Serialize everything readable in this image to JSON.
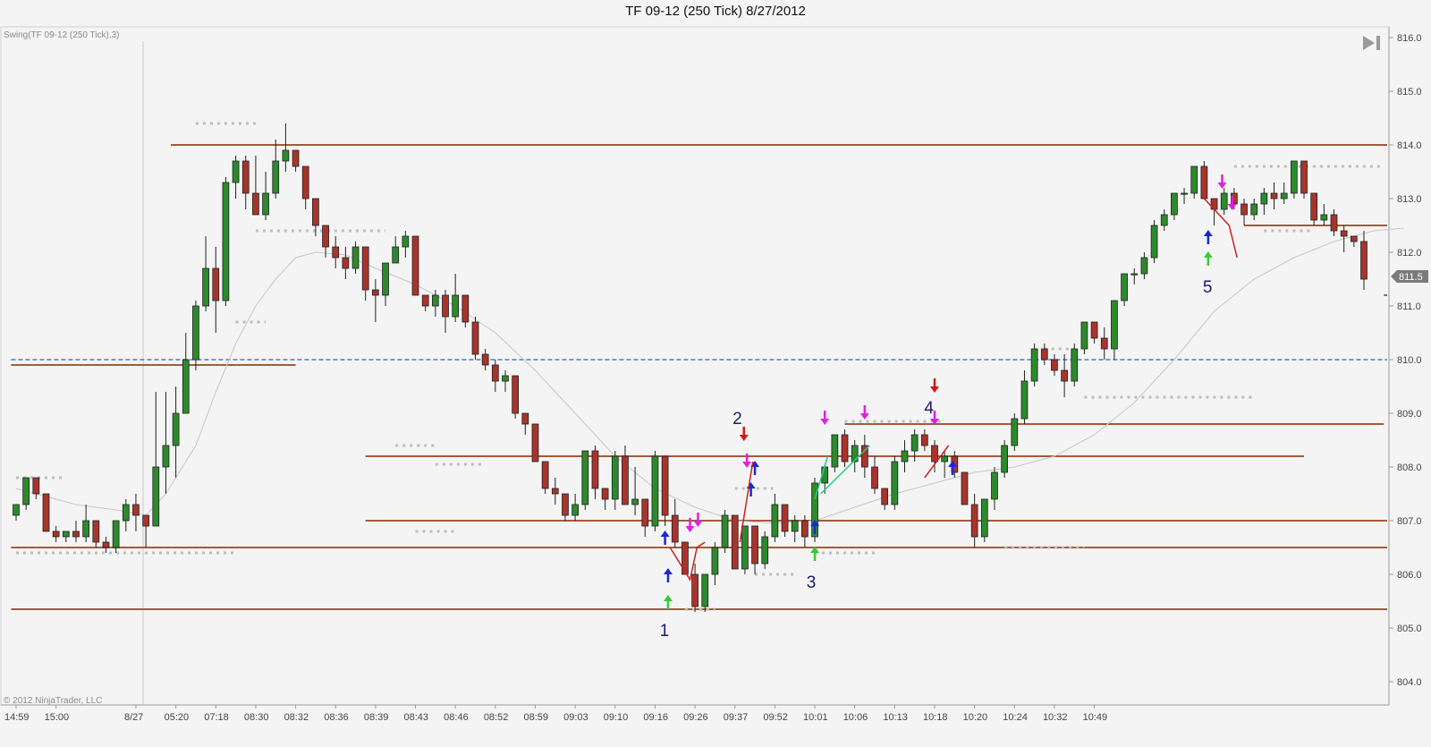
{
  "window": {
    "title": "TF 09-12 (250 Tick)  8/27/2012",
    "indicator_label": "Swing(TF 09-12 (250 Tick),3)",
    "copyright": "© 2012 NinjaTrader, LLC",
    "current_price_label": "811.5"
  },
  "colors": {
    "up_candle": "#2c8a2c",
    "down_candle": "#a8342c",
    "swing_line": "#a45a3a",
    "dotted_level": "#bdbdbd",
    "dashed_level": "#4a7fb5",
    "sma": "#c6c6c6",
    "magenta_arrow": "#e020e0",
    "blue_arrow": "#1a2ad0",
    "green_arrow": "#33cc33",
    "red_arrow": "#d01818",
    "swing_number": "#1a1a70",
    "axis_text": "#444444"
  },
  "icons": {
    "scroll_end": "scroll-to-end-icon"
  },
  "chart_data": {
    "type": "candlestick",
    "title": "TF 09-12 (250 Tick)  8/27/2012",
    "ylim": [
      803.7,
      816.1
    ],
    "y_ticks": [
      "816.0",
      "815.0",
      "814.0",
      "813.0",
      "812.0",
      "811.0",
      "810.0",
      "809.0",
      "808.0",
      "807.0",
      "806.0",
      "805.0",
      "804.0"
    ],
    "x_ticks": [
      {
        "i": 0,
        "label": "14:59"
      },
      {
        "i": 4,
        "label": "15:00"
      },
      {
        "i": 12,
        "label": "8/27"
      },
      {
        "i": 16,
        "label": "05:20"
      },
      {
        "i": 20,
        "label": "07:18"
      },
      {
        "i": 24,
        "label": "08:30"
      },
      {
        "i": 28,
        "label": "08:32"
      },
      {
        "i": 32,
        "label": "08:36"
      },
      {
        "i": 36,
        "label": "08:39"
      },
      {
        "i": 40,
        "label": "08:43"
      },
      {
        "i": 44,
        "label": "08:46"
      },
      {
        "i": 48,
        "label": "08:52"
      },
      {
        "i": 52,
        "label": "08:59"
      },
      {
        "i": 56,
        "label": "09:03"
      },
      {
        "i": 60,
        "label": "09:10"
      },
      {
        "i": 64,
        "label": "09:16"
      },
      {
        "i": 68,
        "label": "09:26"
      },
      {
        "i": 72,
        "label": "09:37"
      },
      {
        "i": 76,
        "label": "09:52"
      },
      {
        "i": 80,
        "label": "10:01"
      },
      {
        "i": 84,
        "label": "10:06"
      },
      {
        "i": 88,
        "label": "10:13"
      },
      {
        "i": 92,
        "label": "10:18"
      },
      {
        "i": 96,
        "label": "10:20"
      },
      {
        "i": 100,
        "label": "10:24"
      },
      {
        "i": 104,
        "label": "10:32"
      },
      {
        "i": 108,
        "label": "10:49"
      }
    ],
    "candles": [
      [
        807.1,
        807.3,
        807.0,
        807.3
      ],
      [
        807.3,
        807.8,
        807.2,
        807.8
      ],
      [
        807.8,
        807.8,
        807.4,
        807.5
      ],
      [
        807.5,
        807.5,
        806.8,
        806.8
      ],
      [
        806.8,
        806.9,
        806.6,
        806.7
      ],
      [
        806.7,
        806.8,
        806.6,
        806.8
      ],
      [
        806.8,
        807.0,
        806.6,
        806.7
      ],
      [
        806.7,
        807.3,
        806.6,
        807.0
      ],
      [
        807.0,
        807.0,
        806.5,
        806.6
      ],
      [
        806.6,
        806.7,
        806.4,
        806.5
      ],
      [
        806.5,
        807.0,
        806.4,
        807.0
      ],
      [
        807.0,
        807.4,
        806.8,
        807.3
      ],
      [
        807.3,
        807.5,
        806.8,
        807.1
      ],
      [
        807.1,
        807.1,
        806.5,
        806.9
      ],
      [
        806.9,
        809.4,
        806.9,
        808.0
      ],
      [
        808.0,
        809.4,
        807.5,
        808.4
      ],
      [
        808.4,
        809.5,
        807.8,
        809.0
      ],
      [
        809.0,
        810.5,
        809.0,
        810.0
      ],
      [
        810.0,
        811.1,
        809.8,
        811.0
      ],
      [
        811.0,
        812.3,
        810.9,
        811.7
      ],
      [
        811.7,
        812.1,
        810.5,
        811.1
      ],
      [
        811.1,
        813.4,
        811.0,
        813.3
      ],
      [
        813.3,
        813.8,
        813.0,
        813.7
      ],
      [
        813.7,
        813.8,
        812.8,
        813.1
      ],
      [
        813.1,
        813.8,
        812.7,
        812.7
      ],
      [
        812.7,
        813.5,
        812.6,
        813.1
      ],
      [
        813.1,
        814.1,
        813.0,
        813.7
      ],
      [
        813.7,
        814.4,
        813.5,
        813.9
      ],
      [
        813.9,
        813.9,
        813.5,
        813.6
      ],
      [
        813.6,
        813.6,
        812.8,
        813.0
      ],
      [
        813.0,
        813.0,
        812.3,
        812.5
      ],
      [
        812.5,
        812.5,
        811.9,
        812.1
      ],
      [
        812.1,
        812.3,
        811.7,
        811.9
      ],
      [
        811.9,
        812.1,
        811.5,
        811.7
      ],
      [
        811.7,
        812.2,
        811.6,
        812.1
      ],
      [
        812.1,
        812.1,
        811.1,
        811.3
      ],
      [
        811.3,
        811.5,
        810.7,
        811.2
      ],
      [
        811.2,
        811.6,
        811.0,
        811.8
      ],
      [
        811.8,
        812.3,
        811.8,
        812.1
      ],
      [
        812.1,
        812.4,
        811.9,
        812.3
      ],
      [
        812.3,
        812.3,
        811.2,
        811.2
      ],
      [
        811.2,
        811.2,
        810.9,
        811.0
      ],
      [
        811.0,
        811.3,
        810.8,
        811.2
      ],
      [
        811.2,
        811.3,
        810.5,
        810.8
      ],
      [
        810.8,
        811.6,
        810.7,
        811.2
      ],
      [
        811.2,
        811.2,
        810.6,
        810.7
      ],
      [
        810.7,
        810.8,
        810.0,
        810.1
      ],
      [
        810.1,
        810.2,
        809.8,
        809.9
      ],
      [
        809.9,
        810.0,
        809.4,
        809.6
      ],
      [
        809.6,
        809.8,
        809.4,
        809.7
      ],
      [
        809.7,
        809.7,
        808.9,
        809.0
      ],
      [
        809.0,
        809.0,
        808.6,
        808.8
      ],
      [
        808.8,
        808.8,
        808.1,
        808.1
      ],
      [
        808.1,
        808.1,
        807.5,
        807.6
      ],
      [
        807.6,
        807.8,
        807.3,
        807.5
      ],
      [
        807.5,
        807.5,
        807.0,
        807.1
      ],
      [
        807.1,
        807.5,
        807.0,
        807.3
      ],
      [
        807.3,
        808.3,
        807.2,
        808.3
      ],
      [
        808.3,
        808.4,
        807.4,
        807.6
      ],
      [
        807.6,
        807.6,
        807.2,
        807.4
      ],
      [
        807.4,
        808.3,
        807.2,
        808.2
      ],
      [
        808.2,
        808.4,
        807.3,
        807.3
      ],
      [
        807.3,
        808.0,
        807.1,
        807.4
      ],
      [
        807.4,
        807.4,
        806.7,
        806.9
      ],
      [
        806.9,
        808.3,
        806.8,
        808.2
      ],
      [
        808.2,
        808.2,
        806.9,
        807.1
      ],
      [
        807.1,
        807.4,
        806.5,
        806.6
      ],
      [
        806.6,
        806.6,
        806.0,
        806.0
      ],
      [
        806.0,
        806.2,
        805.3,
        805.4
      ],
      [
        805.4,
        806.0,
        805.3,
        806.0
      ],
      [
        806.0,
        806.6,
        805.8,
        806.5
      ],
      [
        806.5,
        807.2,
        806.4,
        807.1
      ],
      [
        807.1,
        807.1,
        806.1,
        806.1
      ],
      [
        806.1,
        806.9,
        806.0,
        806.9
      ],
      [
        806.9,
        806.9,
        806.0,
        806.2
      ],
      [
        806.2,
        806.8,
        806.1,
        806.7
      ],
      [
        806.7,
        807.5,
        806.6,
        807.3
      ],
      [
        807.3,
        807.3,
        806.7,
        806.8
      ],
      [
        806.8,
        807.1,
        806.6,
        807.0
      ],
      [
        807.0,
        807.1,
        806.5,
        806.7
      ],
      [
        806.7,
        807.8,
        806.6,
        807.7
      ],
      [
        807.7,
        808.0,
        807.5,
        808.0
      ],
      [
        808.0,
        808.6,
        807.9,
        808.6
      ],
      [
        808.6,
        808.7,
        808.0,
        808.1
      ],
      [
        808.1,
        808.5,
        807.9,
        808.4
      ],
      [
        808.4,
        808.6,
        807.8,
        808.0
      ],
      [
        808.0,
        808.2,
        807.5,
        807.6
      ],
      [
        807.6,
        807.6,
        807.2,
        807.3
      ],
      [
        807.3,
        808.2,
        807.2,
        808.1
      ],
      [
        808.1,
        808.5,
        807.9,
        808.3
      ],
      [
        808.3,
        808.7,
        808.1,
        808.6
      ],
      [
        808.6,
        808.7,
        808.3,
        808.4
      ],
      [
        808.4,
        808.5,
        807.9,
        808.1
      ],
      [
        808.1,
        808.3,
        807.8,
        808.2
      ],
      [
        808.2,
        808.3,
        807.8,
        807.9
      ],
      [
        807.9,
        807.9,
        807.4,
        807.3
      ],
      [
        807.3,
        807.5,
        806.5,
        806.7
      ],
      [
        806.7,
        807.4,
        806.6,
        807.4
      ],
      [
        807.4,
        808.0,
        807.2,
        807.9
      ],
      [
        807.9,
        808.5,
        807.8,
        808.4
      ],
      [
        808.4,
        809.0,
        808.3,
        808.9
      ],
      [
        808.9,
        809.8,
        808.8,
        809.6
      ],
      [
        809.6,
        810.3,
        809.5,
        810.2
      ],
      [
        810.2,
        810.3,
        809.9,
        810.0
      ],
      [
        810.0,
        810.1,
        809.7,
        809.8
      ],
      [
        809.8,
        810.1,
        809.3,
        809.6
      ],
      [
        809.6,
        810.3,
        809.5,
        810.2
      ],
      [
        810.2,
        810.7,
        810.1,
        810.7
      ],
      [
        810.7,
        810.7,
        810.3,
        810.4
      ],
      [
        810.4,
        810.6,
        810.0,
        810.2
      ],
      [
        810.2,
        811.1,
        810.0,
        811.1
      ],
      [
        811.1,
        811.6,
        811.0,
        811.6
      ],
      [
        811.6,
        811.7,
        811.4,
        811.6
      ],
      [
        811.6,
        812.0,
        811.5,
        811.9
      ],
      [
        811.9,
        812.6,
        811.8,
        812.5
      ],
      [
        812.5,
        812.8,
        812.4,
        812.7
      ],
      [
        812.7,
        813.1,
        812.6,
        813.1
      ],
      [
        813.1,
        813.2,
        812.9,
        813.1
      ],
      [
        813.1,
        813.6,
        813.0,
        813.6
      ],
      [
        813.6,
        813.7,
        813.0,
        813.0
      ],
      [
        813.0,
        813.0,
        812.5,
        812.8
      ],
      [
        812.8,
        813.2,
        812.7,
        813.1
      ],
      [
        813.1,
        813.2,
        812.8,
        812.9
      ],
      [
        812.9,
        813.0,
        812.5,
        812.7
      ],
      [
        812.7,
        813.0,
        812.6,
        812.9
      ],
      [
        812.9,
        813.2,
        812.7,
        813.1
      ],
      [
        813.1,
        813.3,
        812.8,
        813.0
      ],
      [
        813.0,
        813.3,
        812.9,
        813.1
      ],
      [
        813.1,
        813.7,
        813.0,
        813.7
      ],
      [
        813.7,
        813.7,
        813.0,
        813.1
      ],
      [
        813.1,
        813.1,
        812.5,
        812.6
      ],
      [
        812.6,
        812.9,
        812.5,
        812.7
      ],
      [
        812.7,
        812.8,
        812.3,
        812.4
      ],
      [
        812.4,
        812.5,
        812.0,
        812.3
      ],
      [
        812.3,
        812.3,
        812.1,
        812.2
      ],
      [
        812.2,
        812.4,
        811.3,
        811.5
      ]
    ],
    "sma": [
      [
        0,
        807.6
      ],
      [
        6,
        807.3
      ],
      [
        10,
        807.2
      ],
      [
        13,
        807.1
      ],
      [
        15,
        807.5
      ],
      [
        18,
        808.4
      ],
      [
        20,
        809.4
      ],
      [
        22,
        810.3
      ],
      [
        24,
        811.0
      ],
      [
        26,
        811.5
      ],
      [
        28,
        811.9
      ],
      [
        30,
        812.0
      ],
      [
        33,
        811.95
      ],
      [
        36,
        811.7
      ],
      [
        40,
        811.4
      ],
      [
        44,
        811.0
      ],
      [
        48,
        810.5
      ],
      [
        52,
        809.8
      ],
      [
        56,
        809.0
      ],
      [
        60,
        808.2
      ],
      [
        64,
        807.6
      ],
      [
        68,
        807.25
      ],
      [
        72,
        807.0
      ],
      [
        76,
        806.95
      ],
      [
        80,
        807.0
      ],
      [
        84,
        807.25
      ],
      [
        88,
        807.5
      ],
      [
        92,
        807.7
      ],
      [
        96,
        807.9
      ],
      [
        100,
        808.0
      ],
      [
        104,
        808.2
      ],
      [
        108,
        808.6
      ],
      [
        112,
        809.2
      ],
      [
        116,
        810.0
      ],
      [
        120,
        810.9
      ],
      [
        124,
        811.5
      ],
      [
        128,
        811.9
      ],
      [
        132,
        812.2
      ],
      [
        136,
        812.4
      ],
      [
        139,
        812.45
      ]
    ]
  }
}
